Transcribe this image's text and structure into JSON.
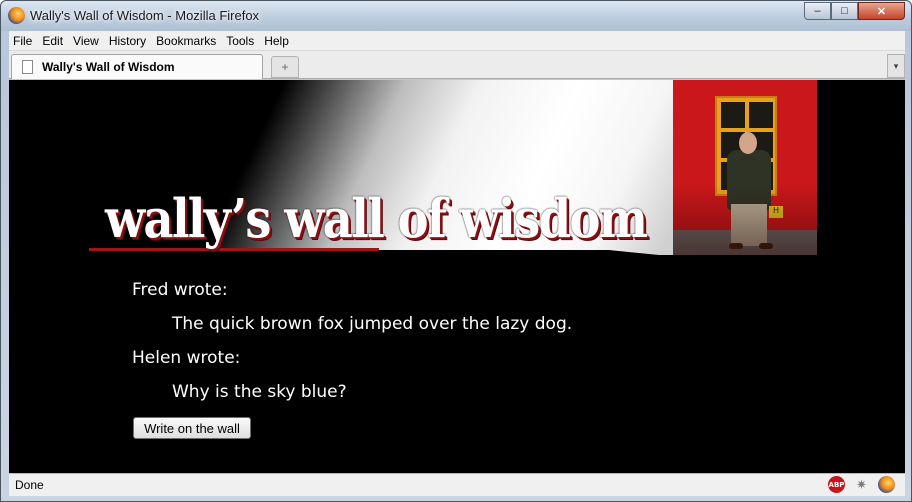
{
  "window": {
    "title": "Wally's Wall of Wisdom - Mozilla Firefox",
    "minimize_label": "–",
    "maximize_label": "□",
    "close_label": "✕"
  },
  "menubar": {
    "items": [
      "File",
      "Edit",
      "View",
      "History",
      "Bookmarks",
      "Tools",
      "Help"
    ]
  },
  "tabs": [
    {
      "label": "Wally's Wall of Wisdom",
      "icon": "page-icon",
      "active": true
    }
  ],
  "new_tab_label": "+",
  "tab_list_label": "▾",
  "page": {
    "logo_text": "wally’s wall of wisdom",
    "photo_sign": "H",
    "posts": [
      {
        "author": "Fred wrote:",
        "message": "The quick brown fox jumped over the lazy dog."
      },
      {
        "author": "Helen wrote:",
        "message": "Why is the sky blue?"
      }
    ],
    "write_button": "Write on the wall"
  },
  "statusbar": {
    "status": "Done",
    "icons": [
      "adblock-plus-icon",
      "firebug-icon",
      "firefox-icon"
    ],
    "abp_label": "ABP",
    "bug_label": "✷"
  },
  "colors": {
    "page_background": "#000000",
    "logo_shadow": "#8a1014",
    "photo_wall": "#c9171b"
  }
}
